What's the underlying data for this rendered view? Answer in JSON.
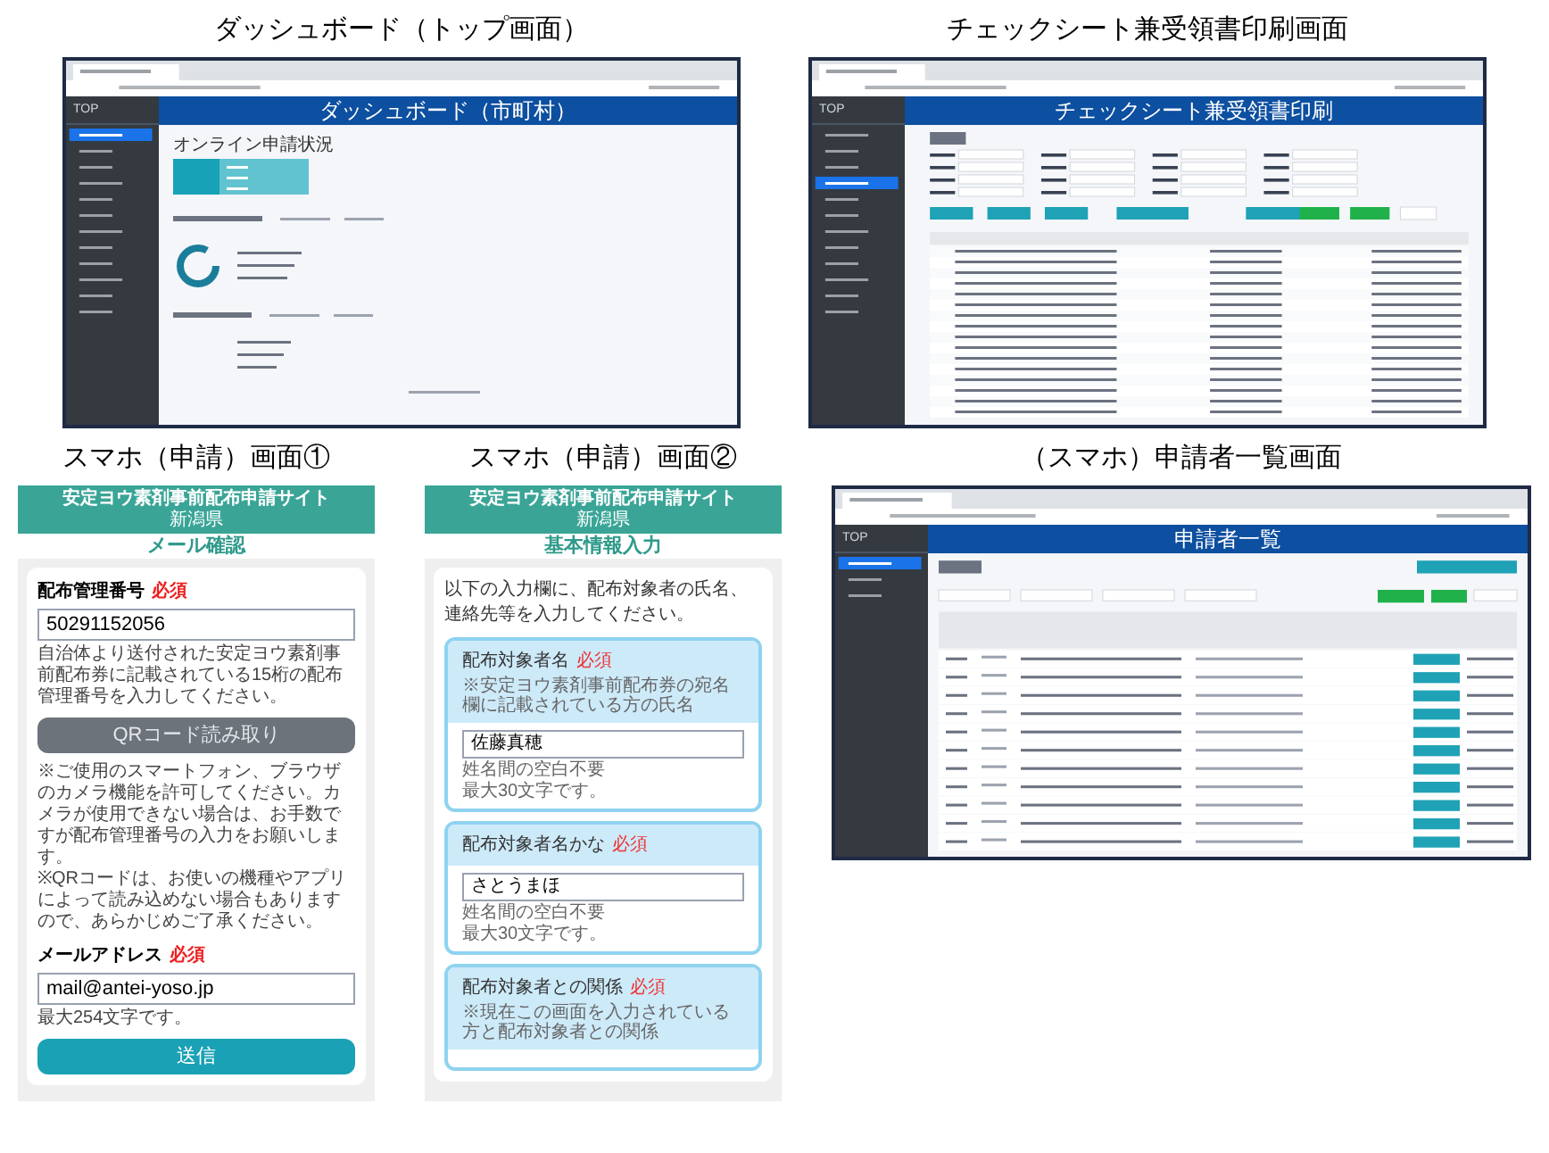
{
  "top_row": [
    {
      "kind": "dashboard_screen",
      "caption": "ダッシュボード（トップ画面）",
      "sidebar_title": "TOP",
      "header_title": "ダッシュボード（市町村）",
      "section_title": "オンライン申請状況"
    },
    {
      "kind": "checksheet_screen",
      "caption": "チェックシート兼受領書印刷画面",
      "sidebar_title": "TOP",
      "header_title": "チェックシート兼受領書印刷"
    }
  ],
  "bottom_row": [
    {
      "kind": "phone_form",
      "caption": "スマホ（申請）画面①",
      "site_title": "安定ヨウ素剤事前配布申請サイト",
      "prefecture": "新潟県",
      "step_title": "メール確認",
      "items": [
        {
          "kind": "field",
          "label": "配布管理番号",
          "required": "必須",
          "value": "50291152056",
          "hints": [
            "自治体より送付された安定ヨウ素剤事前配布券に記載されている15桁の配布管理番号を入力してください。"
          ]
        },
        {
          "kind": "secondary_button",
          "label": "QRコード読み取り"
        },
        {
          "kind": "notes",
          "lines": [
            "※ご使用のスマートフォン、ブラウザのカメラ機能を許可してください。カメラが使用できない場合は、お手数ですが配布管理番号の入力をお願いします。",
            "※QRコードは、お使いの機種やアプリによって読み込めない場合もありますので、あらかじめご了承ください。"
          ]
        },
        {
          "kind": "field",
          "label": "メールアドレス",
          "required": "必須",
          "value": "mail@antei-yoso.jp",
          "hints": [
            "最大254文字です。"
          ]
        },
        {
          "kind": "primary_button",
          "label": "送信"
        }
      ]
    },
    {
      "kind": "phone_form",
      "caption": "スマホ（申請）画面②",
      "site_title": "安定ヨウ素剤事前配布申請サイト",
      "prefecture": "新潟県",
      "step_title": "基本情報入力",
      "items": [
        {
          "kind": "intro",
          "text": "以下の入力欄に、配布対象者の氏名、連絡先等を入力してください。"
        },
        {
          "kind": "card",
          "label": "配布対象者名",
          "required": "必須",
          "note": "※安定ヨウ素剤事前配布券の宛名欄に記載されている方の氏名",
          "value": "佐藤真穂",
          "hints": [
            "姓名間の空白不要",
            "最大30文字です。"
          ]
        },
        {
          "kind": "card",
          "label": "配布対象者名かな",
          "required": "必須",
          "value": "さとうまほ",
          "hints": [
            "姓名間の空白不要",
            "最大30文字です。"
          ]
        },
        {
          "kind": "card",
          "label": "配布対象者との関係",
          "required": "必須",
          "note": "※現在この画面を入力されている方と配布対象者との関係"
        }
      ]
    },
    {
      "kind": "list_screen",
      "caption": "（スマホ）申請者一覧画面",
      "sidebar_title": "TOP",
      "header_title": "申請者一覧"
    }
  ]
}
